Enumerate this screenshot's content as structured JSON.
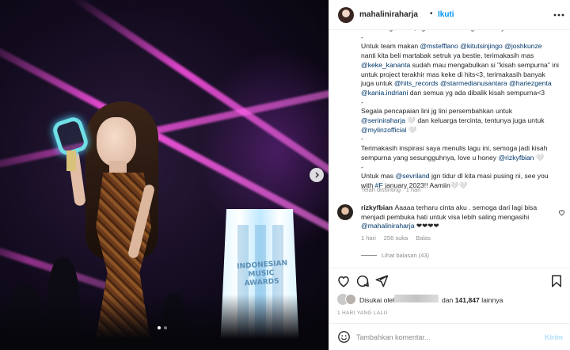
{
  "header": {
    "username": "mahaliniraharja",
    "separator": "•",
    "follow_label": "Ikuti",
    "more_icon": "more-dots-icon"
  },
  "media": {
    "award_text": "INDONESIAN MUSIC AWARDS",
    "next_icon": "chevron-right-icon",
    "carousel_count": 2,
    "carousel_active": 1
  },
  "caption": {
    "lines": [
      [
        {
          "t": "sudah bagi musik, agar terus semangat berkarya"
        }
      ],
      [
        {
          "t": "-"
        }
      ],
      [
        {
          "t": "Untuk team makan "
        },
        {
          "t": "@mstefflano",
          "m": true
        },
        {
          "t": " "
        },
        {
          "t": "@kitutsinjingo",
          "m": true
        },
        {
          "t": " "
        },
        {
          "t": "@joshkunze",
          "m": true
        }
      ],
      [
        {
          "t": "nanti kita beli martabak setruk ya bestie, terimakasih mas"
        }
      ],
      [
        {
          "t": "@keke_kananta",
          "m": true
        },
        {
          "t": " sudah mau mengabulkan si \"kisah sempurna\" ini"
        }
      ],
      [
        {
          "t": "untuk project terakhir mas keke di hits<3, terimakasih banyak"
        }
      ],
      [
        {
          "t": "juga untuk "
        },
        {
          "t": "@hits_records",
          "m": true
        },
        {
          "t": " "
        },
        {
          "t": "@starmedianusantara",
          "m": true
        },
        {
          "t": " "
        },
        {
          "t": "@hariezgenta",
          "m": true
        }
      ],
      [
        {
          "t": "@kania.indriani",
          "m": true
        },
        {
          "t": " dan semua yg ada dibalik kisah sempurna<3"
        }
      ],
      [
        {
          "t": "-"
        }
      ],
      [
        {
          "t": "Segala pencapaian lini jg lini persembahkan untuk"
        }
      ],
      [
        {
          "t": "@seriniraharja",
          "m": true
        },
        {
          "t": " 🤍 dan keluarga tercinta, tentunya juga untuk"
        }
      ],
      [
        {
          "t": "@mylinzofficial",
          "m": true
        },
        {
          "t": " 🤍"
        }
      ],
      [
        {
          "t": "-"
        }
      ],
      [
        {
          "t": "Terimakasih inspirasi saya menulis lagu ini, semoga jadi kisah"
        }
      ],
      [
        {
          "t": "sempurna yang sesungguhnya, love u honey "
        },
        {
          "t": "@rizkyfbian",
          "m": true
        },
        {
          "t": " 🤍"
        }
      ],
      [
        {
          "t": "-"
        }
      ],
      [
        {
          "t": "Untuk mas "
        },
        {
          "t": "@sevriland",
          "m": true
        },
        {
          "t": " jgn tidur dl kita masi pusing ni, see you"
        }
      ],
      [
        {
          "t": "with "
        },
        {
          "t": "#F",
          "m": true
        },
        {
          "t": " january 2023!! Aamiin🤍🤍"
        }
      ]
    ],
    "edited_label": "Telah disunting · 1 hari"
  },
  "comment": {
    "username": "rizkyfbian",
    "lines": [
      [
        {
          "t": "rizkyfbian ",
          "u": true
        },
        {
          "t": "Aaaaa terharu cinta aku . semoga dari lagi bisa"
        }
      ],
      [
        {
          "t": "menjadi pembuka hati untuk visa lebih saling mengasihi"
        }
      ],
      [
        {
          "t": "@mahaliniraharja",
          "m": true
        },
        {
          "t": " ❤❤❤❤"
        }
      ]
    ],
    "age": "1 hari",
    "likes": "256 suka",
    "reply_label": "Balas",
    "view_replies": "Lihat balasan (43)",
    "heart_icon": "heart-outline-icon"
  },
  "actions": {
    "like_icon": "heart-icon",
    "comment_icon": "comment-icon",
    "share_icon": "share-icon",
    "save_icon": "bookmark-icon"
  },
  "likes": {
    "prefix": "Disukai oleh",
    "suffix_pre": "dan ",
    "count": "141,847",
    "suffix_post": " lainnya"
  },
  "timestamp": "1 HARI YANG LALU",
  "composer": {
    "placeholder": "Tambahkan komentar...",
    "post_label": "Kirim",
    "emoji_icon": "smiley-icon"
  }
}
